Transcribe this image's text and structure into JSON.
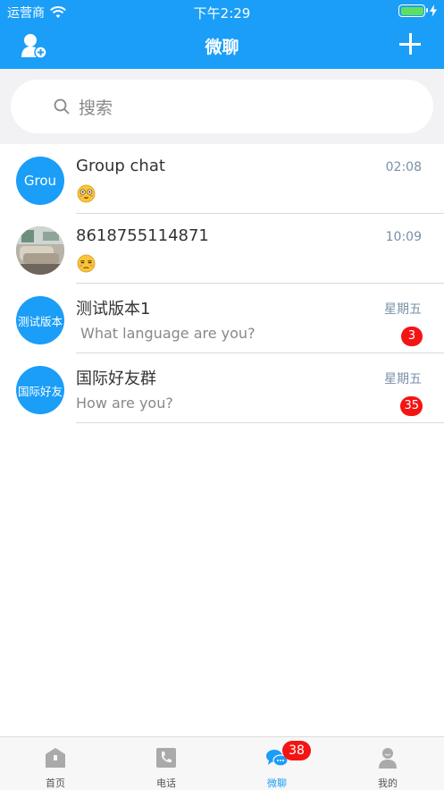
{
  "status_bar": {
    "carrier": "运营商",
    "time": "下午2:29"
  },
  "nav": {
    "title": "微聊"
  },
  "search": {
    "placeholder": "搜索"
  },
  "conversations": [
    {
      "avatar_text": "Grou",
      "name": "Group chat",
      "time": "02:08",
      "preview_emoji": "flushed-face"
    },
    {
      "avatar_text": "",
      "name": "8618755114871",
      "time": "10:09",
      "preview_emoji": "unamused-face"
    },
    {
      "avatar_text": "测试版本",
      "name": "测试版本1",
      "time": "星期五",
      "preview": "What language are you?",
      "unread": "3"
    },
    {
      "avatar_text": "国际好友",
      "name": "国际好友群",
      "time": "星期五",
      "preview": "How are you?",
      "unread": "35"
    }
  ],
  "tabs": [
    {
      "label": "首页",
      "icon": "home-icon"
    },
    {
      "label": "电话",
      "icon": "phone-icon"
    },
    {
      "label": "微聊",
      "icon": "chat-bubbles-icon",
      "badge": "38",
      "active": true
    },
    {
      "label": "我的",
      "icon": "profile-icon"
    }
  ],
  "colors": {
    "accent": "#1a9ef7",
    "badge": "#f41414",
    "search_bg": "#f2f2f4"
  }
}
